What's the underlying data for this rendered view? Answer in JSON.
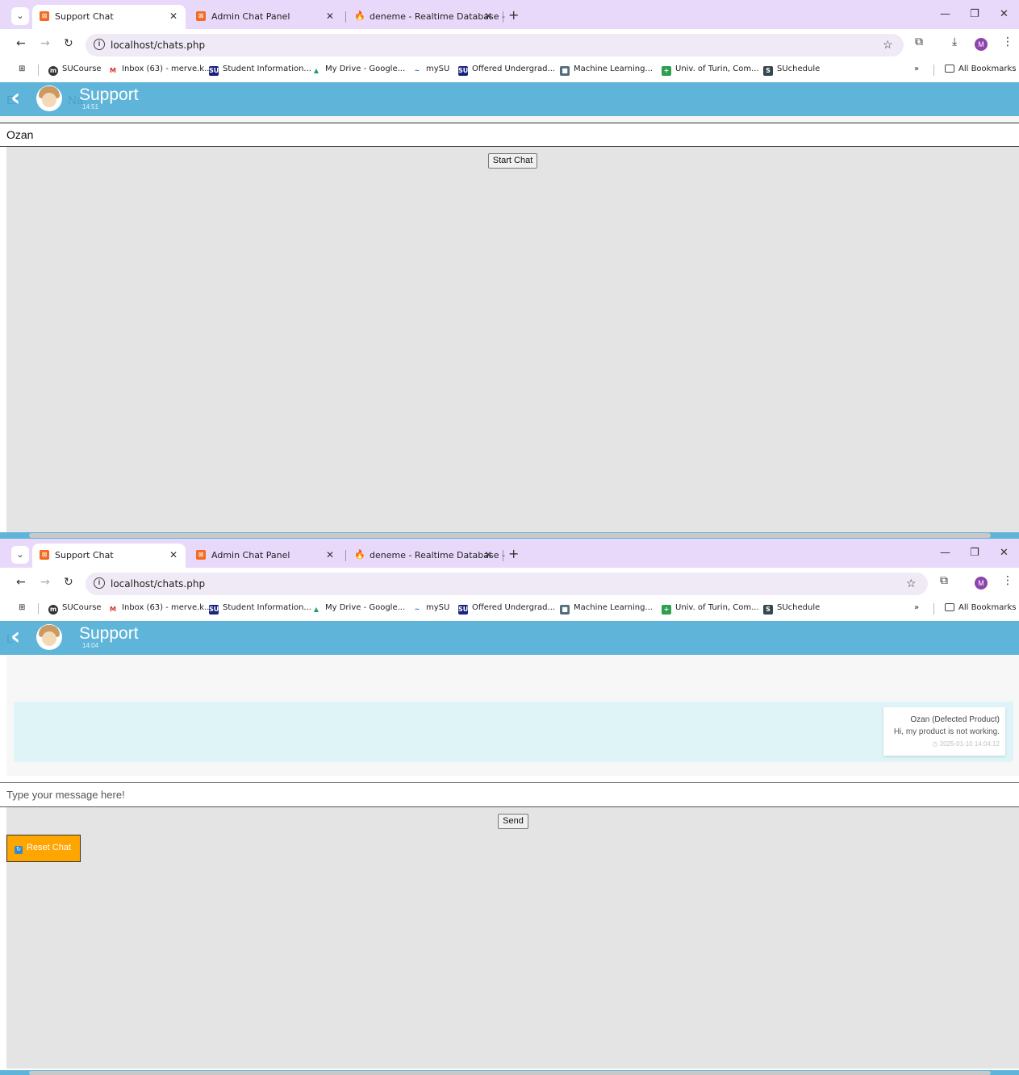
{
  "browser": {
    "tabs": [
      {
        "title": "Support Chat",
        "icon": "xampp-icon",
        "active": true
      },
      {
        "title": "Admin Chat Panel",
        "icon": "xampp-icon",
        "active": false
      },
      {
        "title": "deneme - Realtime Database - ",
        "icon": "firebase-icon",
        "active": false
      }
    ],
    "url": "localhost/chats.php",
    "profile_initial": "M",
    "bookmarks": [
      {
        "label": "SUCourse",
        "icon": "moodle-icon",
        "color": "#333333",
        "glyph": "m"
      },
      {
        "label": "Inbox (63) - merve.k...",
        "icon": "gmail-icon",
        "color": "#d93025",
        "glyph": "M"
      },
      {
        "label": "Student Information...",
        "icon": "su-icon",
        "color": "#1a237e",
        "glyph": "SU"
      },
      {
        "label": "My Drive - Google...",
        "icon": "google-drive-icon",
        "color": "#1fa463",
        "glyph": "▲"
      },
      {
        "label": "mySU",
        "icon": "mysu-icon",
        "color": "#1565c0",
        "glyph": "~"
      },
      {
        "label": "Offered Undergrad...",
        "icon": "su-icon",
        "color": "#1a237e",
        "glyph": "SU"
      },
      {
        "label": "Machine Learning...",
        "icon": "image-icon",
        "color": "#546e7a",
        "glyph": "■"
      },
      {
        "label": "Univ. of Turin, Com...",
        "icon": "plus-icon",
        "color": "#2e9e4f",
        "glyph": "+"
      },
      {
        "label": "SUchedule",
        "icon": "suchedule-icon",
        "color": "#37474f",
        "glyph": "S"
      }
    ],
    "all_bookmarks": "All Bookmarks",
    "overflow": "»"
  },
  "screen1": {
    "header": {
      "title": "Support",
      "time": "14:51",
      "ghost_left": "Er",
      "ghost_right": "Na"
    },
    "name_value": "Ozan",
    "start_button": "Start Chat"
  },
  "screen2": {
    "header": {
      "title": "Support",
      "time": "14:04",
      "ghost_left": "L"
    },
    "message": {
      "sender": "Ozan (Defected Product)",
      "text": "Hi, my product is not working.",
      "timestamp": "◷ 2025-01-10 14:04:12"
    },
    "input_placeholder": "Type your message here!",
    "send_button": "Send",
    "reset_button": "Reset Chat"
  },
  "colors": {
    "header": "#5fb4d9",
    "tabbar": "#e8d9fb",
    "message_row": "#def4f7",
    "reset_button": "#ffa500"
  }
}
